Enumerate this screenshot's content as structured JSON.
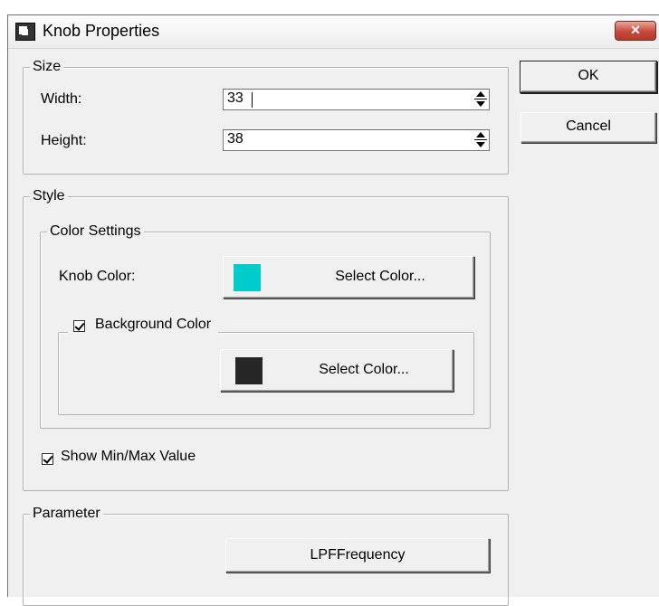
{
  "window": {
    "title": "Knob Properties",
    "close_glyph": "✕"
  },
  "buttons": {
    "ok": "OK",
    "cancel": "Cancel"
  },
  "size": {
    "legend": "Size",
    "width_label": "Width:",
    "width_value": "33",
    "height_label": "Height:",
    "height_value": "38"
  },
  "style": {
    "legend": "Style",
    "color_settings": {
      "legend": "Color Settings",
      "knob_color_label": "Knob Color:",
      "knob_color": "#00cccc",
      "knob_button_label": "Select Color...",
      "background_checkbox_label": "Background Color",
      "background_checked": true,
      "background_color": "#262626",
      "background_button_label": "Select Color..."
    },
    "show_minmax_label": "Show Min/Max Value",
    "show_minmax_checked": true
  },
  "parameter": {
    "legend": "Parameter",
    "button_label": "LPFFrequency"
  }
}
